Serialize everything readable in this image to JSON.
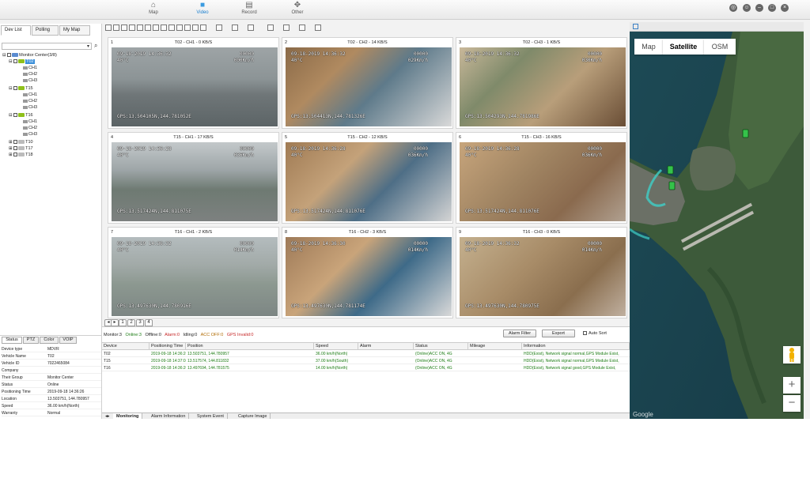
{
  "nav": [
    {
      "label": "Map",
      "icon": "location-pin-icon",
      "active": false
    },
    {
      "label": "Video",
      "icon": "video-camera-icon",
      "active": true
    },
    {
      "label": "Record",
      "icon": "film-record-icon",
      "active": false
    },
    {
      "label": "Other",
      "icon": "grid-menu-icon",
      "active": false
    }
  ],
  "left_tabs": [
    "Dev List",
    "Polling",
    "My Map"
  ],
  "tree": {
    "root": "Monitor Center(3/8)",
    "devices": [
      {
        "name": "T02",
        "selected": true,
        "channels": [
          "CH1",
          "CH2",
          "CH3"
        ]
      },
      {
        "name": "T15",
        "channels": [
          "CH1",
          "CH2",
          "CH3"
        ]
      },
      {
        "name": "T16",
        "channels": [
          "CH1",
          "CH2",
          "CH3"
        ]
      },
      {
        "name": "T10"
      },
      {
        "name": "T17"
      },
      {
        "name": "T18"
      }
    ]
  },
  "status_tabs": [
    "Status",
    "PTZ",
    "Color",
    "VOIP"
  ],
  "status_rows": [
    {
      "k": "Device type",
      "v": "MDVR"
    },
    {
      "k": "Vehicle Name",
      "v": "T02"
    },
    {
      "k": "Vehicle ID",
      "v": "7022465084"
    },
    {
      "k": "Company",
      "v": ""
    },
    {
      "k": "Their Group",
      "v": "Monitor Center"
    },
    {
      "k": "Status",
      "v": "Online"
    },
    {
      "k": "Positioning Time",
      "v": "2019-09-18 14:36:26"
    },
    {
      "k": "Location",
      "v": "13.503751, 144.780957"
    },
    {
      "k": "Speed",
      "v": "36.00 km/h(North)"
    },
    {
      "k": "Warranty",
      "v": "Normal"
    }
  ],
  "videos": [
    {
      "num": "1",
      "title": "T02 - CH1 - 0 KB/S",
      "ts": "09-18-2019 14:36:32",
      "tmp": "40°C",
      "spd": "00000",
      "spd2": "000Km/h",
      "gps": "GPS:13.504105N,144.781052E"
    },
    {
      "num": "2",
      "title": "T02 - CH2 - 14 KB/S",
      "ts": "09-18-2019 14:36:32",
      "tmp": "40°C",
      "spd": "00000",
      "spd2": "029Km/h",
      "gps": "GPS:13.504413N,144.781326E"
    },
    {
      "num": "3",
      "title": "T02 - CH3 - 1 KB/S",
      "ts": "09-18-2019 14:36:32",
      "tmp": "40°C",
      "spd": "00000",
      "spd2": "030Km/h",
      "gps": "GPS:13.504293N,144.781986E"
    },
    {
      "num": "4",
      "title": "T15 - CH1 - 17 KB/S",
      "ts": "09-18-2019 14:36:28",
      "tmp": "40°C",
      "spd": "00000",
      "spd2": "036Km/h",
      "gps": "GPS:13.517424N,144.811075E"
    },
    {
      "num": "5",
      "title": "T15 - CH2 - 12 KB/S",
      "ts": "09-18-2019 14:36:28",
      "tmp": "40°C",
      "spd": "00000",
      "spd2": "036Km/h",
      "gps": "GPS:13.517424N,144.811076E"
    },
    {
      "num": "6",
      "title": "T15 - CH3 - 16 KB/S",
      "ts": "09-18-2019 14:36:28",
      "tmp": "40°C",
      "spd": "00000",
      "spd2": "036Km/h",
      "gps": "GPS:13.517424N,144.811076E"
    },
    {
      "num": "7",
      "title": "T16 - CH1 - 2 KB/S",
      "ts": "09-18-2019 14:36:32",
      "tmp": "40°C",
      "spd": "00000",
      "spd2": "014Km/h",
      "gps": "GPS:13.497630N,144.780916E"
    },
    {
      "num": "8",
      "title": "T16 - CH2 - 3 KB/S",
      "ts": "09-18-2019 14:36:30",
      "tmp": "40°C",
      "spd": "00000",
      "spd2": "014Km/h",
      "gps": "GPS:13.497630N,144.781174E"
    },
    {
      "num": "9",
      "title": "T16 - CH3 - 0 KB/S",
      "ts": "09-18-2019 14:36:32",
      "tmp": "40°C",
      "spd": "00000",
      "spd2": "014Km/h",
      "gps": "GPS:13.497630N,144.780975E"
    }
  ],
  "page_tabs": [
    "1",
    "2",
    "3",
    "4"
  ],
  "summary": {
    "monitor": "Monitor:3",
    "online": "Online:3",
    "offline": "Offline:0",
    "alarm": "Alarm:0",
    "idling": "Idling:0",
    "acc_off": "ACC OFF:0",
    "gps_invalid": "GPS Invalid:0"
  },
  "buttons": {
    "alarm_filter": "Alarm Filter",
    "export": "Export",
    "auto_sort": "Auto Sort"
  },
  "table": {
    "headers": [
      "Device",
      "Positioning Time",
      "Position",
      "Speed",
      "Alarm",
      "Status",
      "Mileage",
      "Information"
    ],
    "rows": [
      [
        "T02",
        "2019-09-18 14:36:26",
        "13.503751, 144.780957",
        "36.00 km/h(North)",
        "",
        "(Online)ACC ON, 4G",
        "",
        "HDD(Exist), Network signal normal,GPS Module Exist,"
      ],
      [
        "T15",
        "2019-09-18 14:37:03",
        "13.517574, 144.811832",
        "37.00 km/h(South)",
        "",
        "(Online)ACC ON, 4G",
        "",
        "HDD(Exist), Network signal normal,GPS Module Exist,"
      ],
      [
        "T16",
        "2019-09-18 14:36:20",
        "13.497694, 144.781575",
        "14.00 km/h(North)",
        "",
        "(Online)ACC ON, 4G",
        "",
        "HDD(Exist), Network signal good,GPS Module Exist,"
      ]
    ]
  },
  "bottom_tabs": [
    "Monitoring",
    "Alarm Information",
    "System Event",
    "Capture Image"
  ],
  "map": {
    "types": [
      "Map",
      "Satellite",
      "OSM"
    ],
    "active_type": "Satellite",
    "zoom_in": "+",
    "zoom_out": "−",
    "attribution": "Google"
  },
  "colors": {
    "accent": "#1a7fcf",
    "online": "#1e7d16",
    "alarm": "#c62828",
    "vehicle": "#35c24a"
  }
}
